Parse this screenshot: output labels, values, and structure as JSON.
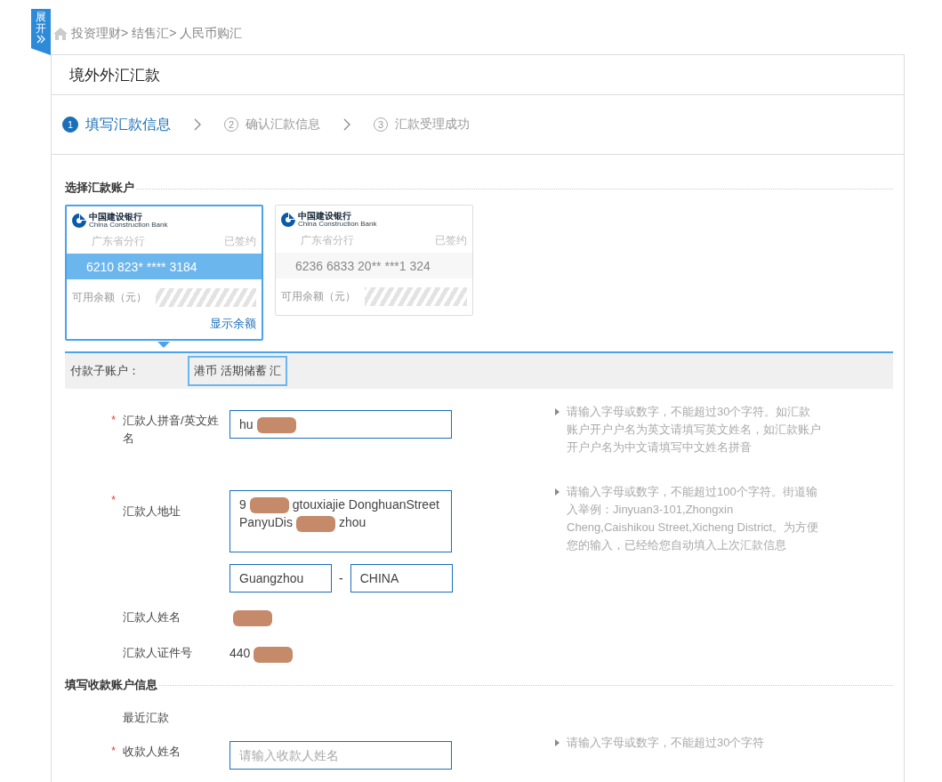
{
  "sidebar_toggle": {
    "label": "展开"
  },
  "breadcrumb": [
    "投资理财>",
    "结售汇>",
    "人民币购汇"
  ],
  "title": "境外外汇汇款",
  "steps": [
    {
      "number": "1",
      "label": "填写汇款信息",
      "selected": true
    },
    {
      "number": "2",
      "label": "确认汇款信息",
      "selected": false
    },
    {
      "number": "3",
      "label": "汇款受理成功",
      "selected": false
    }
  ],
  "accounts_section": {
    "title": "选择汇款账户",
    "accounts": [
      {
        "bank_name": "中国建设银行",
        "bank_name_en": "China Construction Bank",
        "branch": "广东省分行",
        "status": "已签约",
        "number": "6210 823* **** 3184",
        "balance_label": "可用余额（元）",
        "action": "显示余额",
        "selected": true
      },
      {
        "bank_name": "中国建设银行",
        "bank_name_en": "China Construction Bank",
        "branch": "广东省分行",
        "status": "已签约",
        "number": "6236 6833 20** ***1 324",
        "balance_label": "可用余额（元）",
        "selected": false
      }
    ]
  },
  "sub_account": {
    "label": "付款子账户：",
    "value": "港币 活期储蓄 汇"
  },
  "remitter_fields": [
    {
      "kind": "input",
      "label": "汇款人拼音/英文姓名",
      "required_mark": "*",
      "lines": [
        [
          {
            "kind": "text",
            "text": "hu"
          },
          {
            "kind": "redacted"
          }
        ]
      ],
      "hint": "请输入字母或数字，不能超过30个字符。如汇款账户开户户名为英文请填写英文姓名，如汇款账户开户户名为中文请填写中文姓名拼音"
    },
    {
      "kind": "textarea",
      "label": "汇款人地址",
      "required_mark": "*",
      "lines": [
        [
          {
            "kind": "text",
            "text": "9"
          },
          {
            "kind": "redacted"
          },
          {
            "kind": "text",
            "text": "gtouxiajie DonghuanStreet"
          }
        ],
        [
          {
            "kind": "text",
            "text": "PanyuDis"
          },
          {
            "kind": "redacted"
          },
          {
            "kind": "text",
            "text": "zhou"
          }
        ]
      ],
      "hint": "请输入字母或数字，不能超过100个字符。街道输入举例：Jinyuan3-101,Zhongxin Cheng,Caishikou Street,Xicheng District。为方便您的输入，已经给您自动填入上次汇款信息"
    },
    {
      "kind": "pair",
      "values": [
        "Guangzhou",
        "CHINA"
      ],
      "separator": "-"
    },
    {
      "kind": "text",
      "label": "汇款人姓名",
      "lines": [
        [
          {
            "kind": "redacted"
          }
        ]
      ]
    },
    {
      "kind": "text",
      "label": "汇款人证件号",
      "lines": [
        [
          {
            "kind": "text",
            "text": "440"
          },
          {
            "kind": "redacted"
          }
        ]
      ]
    }
  ],
  "payee_section": {
    "title": "填写收款账户信息",
    "fields": [
      {
        "kind": "label",
        "label": "最近汇款"
      },
      {
        "kind": "input",
        "label": "收款人姓名",
        "required_mark": "*",
        "placeholder": "请输入收款人姓名",
        "hint": "请输入字母或数字，不能超过30个字符"
      }
    ]
  }
}
